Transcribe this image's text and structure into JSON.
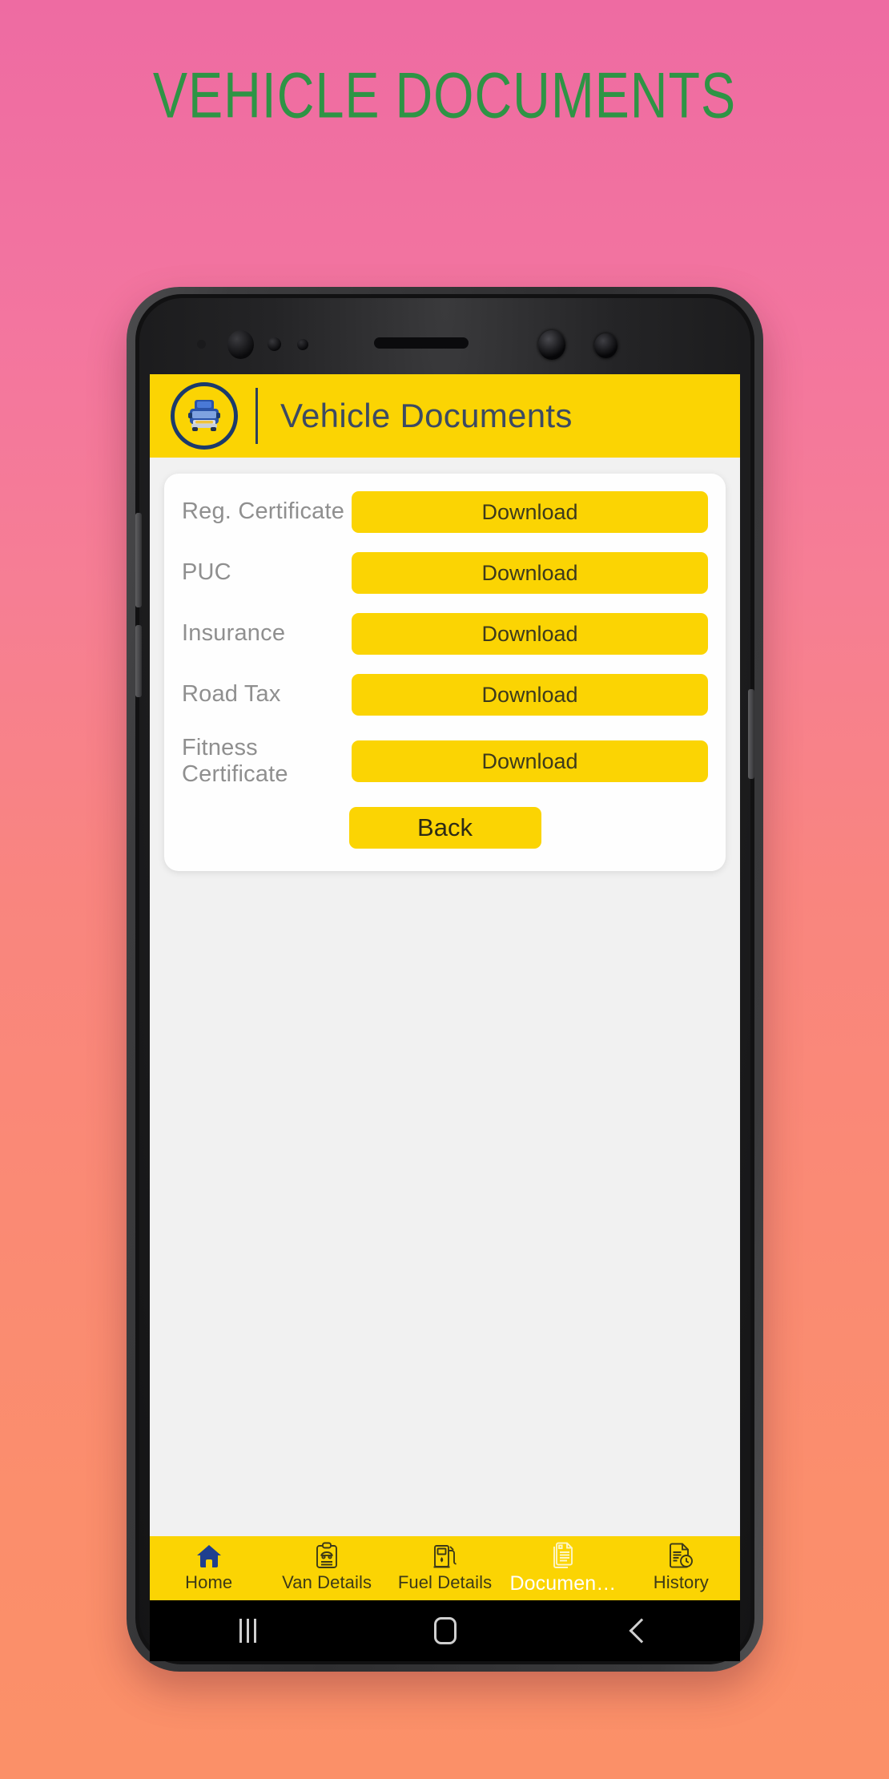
{
  "page": {
    "title": "VEHICLE DOCUMENTS",
    "title_color": "#2e9445",
    "background_gradient": [
      "#ee6ba2",
      "#fb9068"
    ]
  },
  "colors": {
    "accent_yellow": "#fbd403",
    "app_title_blue": "#3c4a63",
    "logo_navy": "#1b3a6b",
    "label_gray": "#8f8f8f",
    "screen_bg": "#f1f1f1",
    "card_bg": "#fefefe"
  },
  "appbar": {
    "logo_icon": "vehicle-circle-icon",
    "title": "Vehicle Documents"
  },
  "card": {
    "documents": [
      {
        "label": "Reg. Certificate",
        "action_label": "Download"
      },
      {
        "label": "PUC",
        "action_label": "Download"
      },
      {
        "label": "Insurance",
        "action_label": "Download"
      },
      {
        "label": "Road Tax",
        "action_label": "Download"
      },
      {
        "label": "Fitness Certificate",
        "action_label": "Download"
      }
    ],
    "back_label": "Back"
  },
  "bottom_nav": {
    "items": [
      {
        "label": "Home",
        "icon": "home-icon",
        "active": false
      },
      {
        "label": "Van Details",
        "icon": "clipboard-car-icon",
        "active": false
      },
      {
        "label": "Fuel Details",
        "icon": "fuel-pump-icon",
        "active": false
      },
      {
        "label": "Documen…",
        "icon": "documents-icon",
        "active": true
      },
      {
        "label": "History",
        "icon": "document-clock-icon",
        "active": false
      }
    ]
  },
  "android_nav": {
    "recents": "recents-icon",
    "home": "home-square-icon",
    "back": "back-chevron-icon"
  }
}
